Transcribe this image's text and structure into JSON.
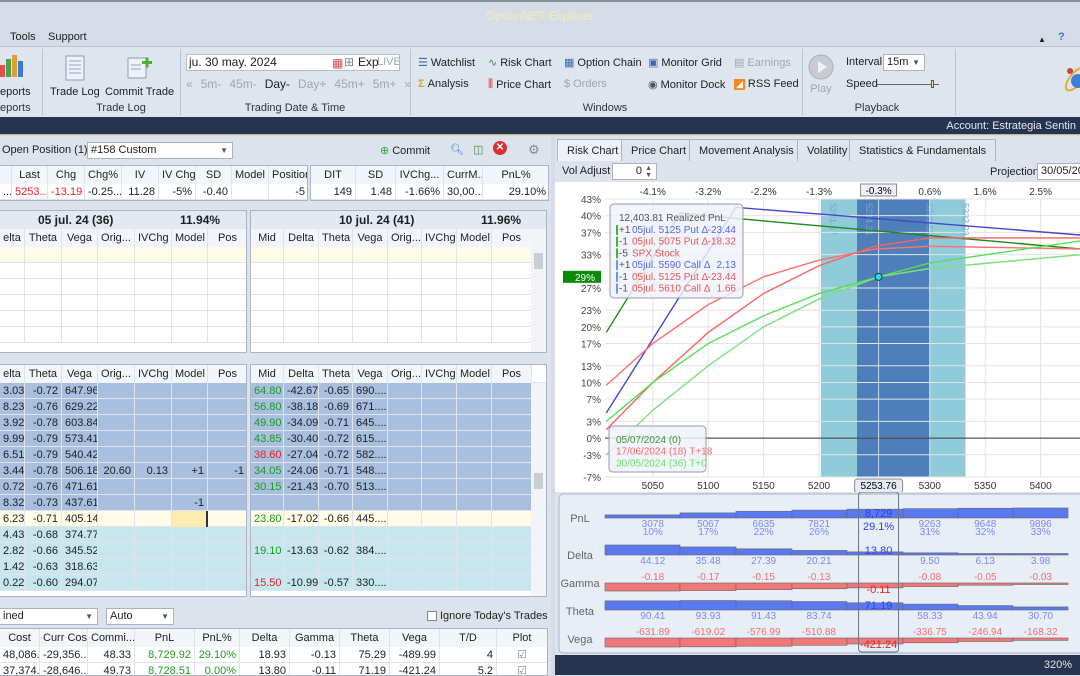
{
  "app": {
    "title": "OptionNET Explorer"
  },
  "menu": {
    "items": [
      "Tools",
      "Support"
    ]
  },
  "ribbon": {
    "reports": {
      "button": "eports",
      "group": "eports"
    },
    "trade_log": {
      "trade_log": "Trade Log",
      "commit_trade": "Commit Trade",
      "group": "Trade Log"
    },
    "trading_date": {
      "date": "ju. 30 may. 2024",
      "exp": "Exp",
      "live": "LIVE",
      "nav": [
        "5m-",
        "45m-",
        "Day-",
        "Day+",
        "45m+",
        "5m+"
      ],
      "group": "Trading Date & Time"
    },
    "windows": {
      "items": [
        "Watchlist",
        "Risk Chart",
        "Option Chain",
        "Monitor Grid",
        "Earnings",
        "Analysis",
        "Price Chart",
        "Orders",
        "Monitor Dock",
        "RSS Feed"
      ],
      "group": "Windows"
    },
    "playback": {
      "play": "Play",
      "interval_label": "Interval",
      "interval": "15m",
      "speed_label": "Speed",
      "group": "Playback"
    }
  },
  "account": "Account: Estrategia Sentin",
  "position": {
    "label": "Open Position (1)",
    "selected": "#158 Custom",
    "commit": "Commit",
    "left_headers": [
      "",
      "Last",
      "Chg",
      "Chg%",
      "IV",
      "IV Chg",
      "SD",
      "Model",
      "Position"
    ],
    "left_row": [
      "...",
      "5253...",
      "-13.19",
      "-0.25...",
      "11.28",
      "-5%",
      "-0.40",
      "",
      "-5"
    ],
    "right_headers": [
      "DIT",
      "SD",
      "IVChg...",
      "CurrM...",
      "PnL%"
    ],
    "right_row": [
      "149",
      "1.48",
      "-1.66%",
      "30,00...",
      "29.10%"
    ]
  },
  "chain_upper": {
    "left": {
      "expiry": "05 jul. 24 (36)",
      "iv": "11.94%",
      "headers": [
        "elta",
        "Theta",
        "Vega",
        "Orig...",
        "IVChg",
        "Model",
        "Pos"
      ]
    },
    "right": {
      "expiry": "10 jul. 24 (41)",
      "iv": "11.96%",
      "headers": [
        "Mid",
        "Delta",
        "Theta",
        "Vega",
        "Orig...",
        "IVChg",
        "Model",
        "Pos"
      ]
    }
  },
  "chain_lower": {
    "left": {
      "headers": [
        "elta",
        "Theta",
        "Vega",
        "Orig...",
        "IVChg",
        "Model",
        "Pos"
      ],
      "rows": [
        [
          "3.03",
          "-0.72",
          "647.96",
          "",
          "",
          "",
          ""
        ],
        [
          "8.23",
          "-0.76",
          "629.22",
          "",
          "",
          "",
          ""
        ],
        [
          "3.92",
          "-0.78",
          "603.84",
          "",
          "",
          "",
          ""
        ],
        [
          "9.99",
          "-0.79",
          "573.41",
          "",
          "",
          "",
          ""
        ],
        [
          "6.51",
          "-0.79",
          "540.42",
          "",
          "",
          "",
          ""
        ],
        [
          "3.44",
          "-0.78",
          "506.18",
          "20.60",
          "0.13",
          "+1",
          "-1"
        ],
        [
          "0.72",
          "-0.76",
          "471.61",
          "",
          "",
          "",
          ""
        ],
        [
          "8.32",
          "-0.73",
          "437.61",
          "",
          "",
          "-1",
          ""
        ],
        [
          "6.23",
          "-0.71",
          "405.14",
          "",
          "",
          "",
          ""
        ],
        [
          "4.43",
          "-0.68",
          "374.77",
          "",
          "",
          "",
          ""
        ],
        [
          "2.82",
          "-0.66",
          "345.52",
          "",
          "",
          "",
          ""
        ],
        [
          "1.42",
          "-0.63",
          "318.63",
          "",
          "",
          "",
          ""
        ],
        [
          "0.22",
          "-0.60",
          "294.07",
          "",
          "",
          "",
          ""
        ]
      ]
    },
    "right": {
      "headers": [
        "Mid",
        "Delta",
        "Theta",
        "Vega",
        "Orig...",
        "IVChg",
        "Model",
        "Pos"
      ],
      "rows": [
        [
          "64.80",
          "-42.67",
          "-0.65",
          "690....",
          "",
          "",
          "",
          ""
        ],
        [
          "56.80",
          "-38.18",
          "-0.69",
          "671....",
          "",
          "",
          "",
          ""
        ],
        [
          "49.90",
          "-34.09",
          "-0.71",
          "645....",
          "",
          "",
          "",
          ""
        ],
        [
          "43.85",
          "-30.40",
          "-0.72",
          "615....",
          "",
          "",
          "",
          ""
        ],
        [
          "38.60",
          "-27.04",
          "-0.72",
          "582....",
          "",
          "",
          "",
          ""
        ],
        [
          "34.05",
          "-24.06",
          "-0.71",
          "548....",
          "",
          "",
          "",
          ""
        ],
        [
          "30.15",
          "-21.43",
          "-0.70",
          "513....",
          "",
          "",
          "",
          ""
        ],
        [
          "",
          "",
          "",
          "",
          "",
          "",
          "",
          ""
        ],
        [
          "23.80",
          "-17.02",
          "-0.66",
          "445....",
          "",
          "",
          "",
          ""
        ],
        [
          "",
          "",
          "",
          "",
          "",
          "",
          "",
          ""
        ],
        [
          "19.10",
          "-13.63",
          "-0.62",
          "384....",
          "",
          "",
          "",
          ""
        ],
        [
          "",
          "",
          "",
          "",
          "",
          "",
          "",
          ""
        ],
        [
          "15.50",
          "-10.99",
          "-0.57",
          "330....",
          "",
          "",
          "",
          ""
        ]
      ],
      "mid_colors": [
        "green",
        "green",
        "green",
        "green",
        "red",
        "green",
        "green",
        "",
        "green",
        "",
        "green",
        "",
        "red"
      ]
    },
    "row_styles": [
      "blue",
      "blue",
      "blue",
      "blue",
      "blue",
      "blue",
      "blue",
      "blue",
      "cream",
      "cyan",
      "cyan",
      "cyan",
      "cyan"
    ]
  },
  "summary": {
    "combo1": "ined",
    "combo2": "Auto",
    "ignore_label": "Ignore Today's Trades",
    "ignore_checked": false,
    "headers": [
      "Cost",
      "Curr Cost",
      "Commi...",
      "PnL",
      "PnL%",
      "Delta",
      "Gamma",
      "Theta",
      "Vega",
      "T/D",
      "Plot"
    ],
    "rows": [
      [
        "48,086....",
        "-29,356...",
        "48.33",
        "8,729.92",
        "29.10%",
        "18.93",
        "-0.13",
        "75.29",
        "-489.99",
        "4",
        "☑"
      ],
      [
        "37,374....",
        "-28,646...",
        "49.73",
        "8,728.51",
        "0.00%",
        "13.80",
        "-0.11",
        "71.19",
        "-421.24",
        "5.2",
        "☑"
      ]
    ]
  },
  "right_panel": {
    "tabs": [
      "Risk Chart",
      "Price Chart",
      "Movement Analysis",
      "Volatility",
      "Statistics & Fundamentals"
    ],
    "active_tab": 0,
    "vol_adjust_label": "Vol Adjust",
    "vol_adjust": "0",
    "projection_label": "Projection",
    "projection": "30/05/20",
    "zoom": "320%"
  },
  "chart_data": {
    "type": "line",
    "xlim": [
      5008,
      5437
    ],
    "ylim": [
      -7,
      43
    ],
    "x_ticks": [
      5050,
      5100,
      5150,
      5200,
      5300,
      5350,
      5400
    ],
    "x_tick_labels": [
      "5050",
      "5100",
      "5150",
      "5200",
      "5300",
      "5350",
      "5400"
    ],
    "top_tick_labels": [
      "-4.1%",
      "-3.2%",
      "-2.2%",
      "-1.3%",
      "0.6%",
      "1.6%",
      "2.5%"
    ],
    "current_price": "5253.76",
    "current_pct": "-0.3%",
    "current_pnl_pct": "29%",
    "y_tick_labels": [
      "43%",
      "40%",
      "37%",
      "33%",
      "27%",
      "23%",
      "20%",
      "17%",
      "13%",
      "10%",
      "7%",
      "3%",
      "0%",
      "-3%",
      "-7%"
    ],
    "y_ticks": [
      43,
      40,
      37,
      33,
      27,
      23,
      20,
      17,
      13,
      10,
      7,
      3,
      0,
      -3,
      -7
    ],
    "bands": [
      {
        "from": 5201.67,
        "to": 5332.23,
        "labels": [
          "5201.67",
          "5332.23"
        ],
        "color": "#8fcbd8"
      },
      {
        "from": 5234.31,
        "to": 5299.59,
        "labels": [
          "5234.31",
          "5299.59"
        ],
        "color": "#4f7fbb"
      }
    ],
    "series": [
      {
        "color": "#1a8a1a",
        "points": [
          [
            5008,
            19
          ],
          [
            5075,
            40.5
          ],
          [
            5125,
            39.5
          ],
          [
            5437,
            34
          ]
        ]
      },
      {
        "color": "#4444cc",
        "points": [
          [
            5008,
            4.5
          ],
          [
            5125,
            41.5
          ],
          [
            5437,
            36.5
          ]
        ]
      },
      {
        "color": "#ff7070",
        "points": [
          [
            5008,
            9.5
          ],
          [
            5050,
            17
          ],
          [
            5100,
            24
          ],
          [
            5150,
            29
          ],
          [
            5200,
            32
          ],
          [
            5250,
            34
          ],
          [
            5300,
            34.5
          ],
          [
            5437,
            34
          ]
        ]
      },
      {
        "color": "#ff6060",
        "points": [
          [
            5008,
            1.5
          ],
          [
            5050,
            10
          ],
          [
            5100,
            19
          ],
          [
            5150,
            26
          ],
          [
            5200,
            31
          ],
          [
            5250,
            34.5
          ],
          [
            5300,
            36
          ],
          [
            5437,
            36
          ]
        ]
      },
      {
        "color": "#55e055",
        "points": [
          [
            5008,
            3
          ],
          [
            5050,
            10
          ],
          [
            5100,
            17
          ],
          [
            5150,
            22
          ],
          [
            5200,
            26
          ],
          [
            5253.76,
            29
          ],
          [
            5300,
            31.5
          ],
          [
            5437,
            35.5
          ]
        ]
      },
      {
        "color": "#7ee07e",
        "points": [
          [
            5008,
            -3
          ],
          [
            5050,
            5
          ],
          [
            5100,
            13
          ],
          [
            5150,
            20
          ],
          [
            5200,
            25
          ],
          [
            5253.76,
            29
          ],
          [
            5300,
            30.5
          ],
          [
            5437,
            33
          ]
        ]
      }
    ],
    "tooltip": {
      "title": "12,403.81 Realized PnL",
      "legs": [
        {
          "qty": "+1",
          "desc": "05jul. 5125 Put Δ",
          "val": "-23.44",
          "color": "#5566ee"
        },
        {
          "qty": "-1",
          "desc": "05jul. 5075 Put Δ",
          "val": "-18.32",
          "color": "#ee5555"
        },
        {
          "qty": "-5",
          "desc": "SPX Stock",
          "val": "",
          "color": "#ee5555"
        },
        {
          "qty": "+1",
          "desc": "05jul. 5590 Call Δ",
          "val": "2.13",
          "color": "#5566ee"
        },
        {
          "qty": "-1",
          "desc": "05jul. 5125 Put Δ",
          "val": "-23.44",
          "color": "#ee5555"
        },
        {
          "qty": "-1",
          "desc": "05jul. 5610 Call Δ",
          "val": "1.66",
          "color": "#ee5555"
        }
      ]
    },
    "legend": [
      {
        "label": "05/07/2024 (0)",
        "color": "#3c9a3c"
      },
      {
        "label": "17/06/2024 (18) T+18",
        "color": "#ff6a6a"
      },
      {
        "label": "30/05/2024 (36) T+0",
        "color": "#6ee06e"
      }
    ]
  },
  "greeks": {
    "columns": [
      "5050",
      "5100",
      "5150",
      "5200",
      "5253.76",
      "5300",
      "5350",
      "5400"
    ],
    "selected": 4,
    "rows": [
      {
        "name": "PnL",
        "values": [
          3078,
          5067,
          6635,
          7821,
          8729,
          9263,
          9648,
          9896
        ],
        "labels": [
          "3078",
          "5067",
          "6635",
          "7821",
          "8,729",
          "9263",
          "9648",
          "9896"
        ],
        "sub": [
          "10%",
          "17%",
          "22%",
          "26%",
          "29.1%",
          "31%",
          "32%",
          "33%"
        ]
      },
      {
        "name": "Delta",
        "values": [
          44.12,
          35.48,
          27.39,
          20.21,
          13.8,
          9.5,
          6.13,
          3.98
        ],
        "labels": [
          "44.12",
          "35.48",
          "27.39",
          "20.21",
          "13.80",
          "9.50",
          "6.13",
          "3.98"
        ]
      },
      {
        "name": "Gamma",
        "values": [
          -0.18,
          -0.17,
          -0.15,
          -0.13,
          -0.11,
          -0.08,
          -0.05,
          -0.03
        ],
        "labels": [
          "-0.18",
          "-0.17",
          "-0.15",
          "-0.13",
          "-0.11",
          "-0.08",
          "-0.05",
          "-0.03"
        ]
      },
      {
        "name": "Theta",
        "values": [
          90.41,
          93.93,
          91.43,
          83.74,
          71.19,
          58.33,
          43.94,
          30.7
        ],
        "labels": [
          "90.41",
          "93.93",
          "91.43",
          "83.74",
          "71.19",
          "58.33",
          "43.94",
          "30.70"
        ]
      },
      {
        "name": "Vega",
        "values": [
          -631.89,
          -619.02,
          -576.99,
          -510.88,
          -421.24,
          -336.75,
          -246.94,
          -168.32
        ],
        "labels": [
          "-631.89",
          "-619.02",
          "-576.99",
          "-510.88",
          "-421.24",
          "-336.75",
          "-246.94",
          "-168.32"
        ]
      }
    ]
  }
}
